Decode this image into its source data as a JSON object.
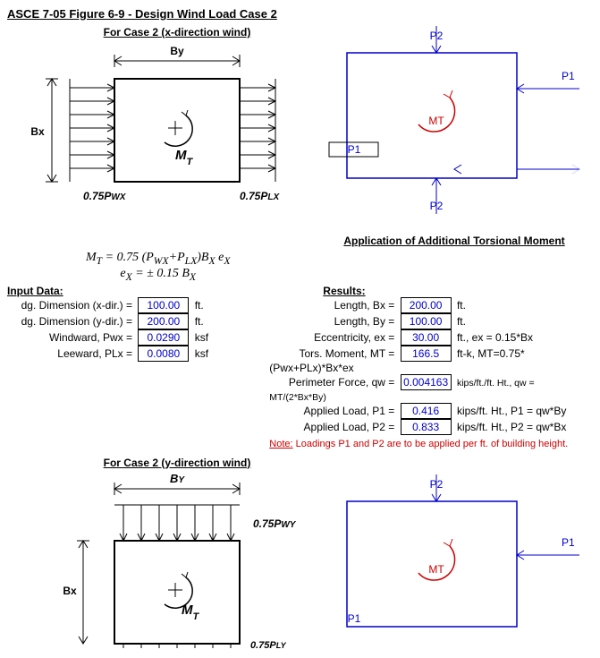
{
  "title": "ASCE 7-05 Figure 6-9 - Design Wind Load Case 2",
  "case2x": {
    "heading": "For Case 2 (x-direction wind)",
    "By": "By",
    "Bx": "Bx",
    "MT": "M",
    "MTsub": "T",
    "leftLbl": "0.75P",
    "leftSub": "WX",
    "rightLbl": "0.75P",
    "rightSub": "LX"
  },
  "case2y": {
    "heading": "For Case 2 (y-direction wind)",
    "By": "B",
    "BySub": "Y",
    "Bx": "Bx",
    "MT": "M",
    "MTsub": "T",
    "topLbl": "0.75P",
    "topSub": "WY",
    "botLbl": "0.75P",
    "botSub": "LY"
  },
  "appTors": {
    "P1": "P1",
    "P2": "P2",
    "MT": "MT",
    "heading": "Application of Additional Torsional Moment"
  },
  "formula": {
    "line1_a": "M",
    "line1_b": "T",
    "line1_c": " = 0.75 (P",
    "line1_d": "WX",
    "line1_e": "+P",
    "line1_f": "LX",
    "line1_g": ")B",
    "line1_h": "X",
    "line1_i": " e",
    "line1_j": "X",
    "line2_a": "e",
    "line2_b": "X",
    "line2_c": " = ± 0.15 B",
    "line2_d": "X"
  },
  "inputs": {
    "heading": "Input Data:",
    "rows": [
      {
        "label": "dg. Dimension (x-dir.) =",
        "value": "100.00",
        "unit": "ft."
      },
      {
        "label": "dg. Dimension (y-dir.) =",
        "value": "200.00",
        "unit": "ft."
      },
      {
        "label": "Windward, Pwx =",
        "value": "0.0290",
        "unit": "ksf"
      },
      {
        "label": "Leeward, PLx =",
        "value": "0.0080",
        "unit": "ksf"
      }
    ]
  },
  "results": {
    "heading": "Results:",
    "rows": [
      {
        "label": "Length, Bx =",
        "value": "200.00",
        "unit": "ft."
      },
      {
        "label": "Length, By =",
        "value": "100.00",
        "unit": "ft."
      },
      {
        "label": "Eccentricity, ex =",
        "value": "30.00",
        "unit": "ft., ex = 0.15*Bx"
      },
      {
        "label": "Tors. Moment, MT =",
        "value": "166.5",
        "unit": "ft-k, MT=0.75*(Pwx+PLx)*Bx*ex"
      },
      {
        "label": "Perimeter Force, qw =",
        "value": "0.004163",
        "unit": "kips/ft./ft. Ht., qw = MT/(2*Bx*By)"
      },
      {
        "label": "Applied Load, P1 =",
        "value": "0.416",
        "unit": "kips/ft. Ht.,  P1 = qw*By"
      },
      {
        "label": "Applied Load, P2 =",
        "value": "0.833",
        "unit": "kips/ft. Ht.,  P2 = qw*Bx"
      }
    ],
    "note_lead": "Note:",
    "note_body": " Loadings P1 and P2 are to be applied per ft. of building height."
  }
}
